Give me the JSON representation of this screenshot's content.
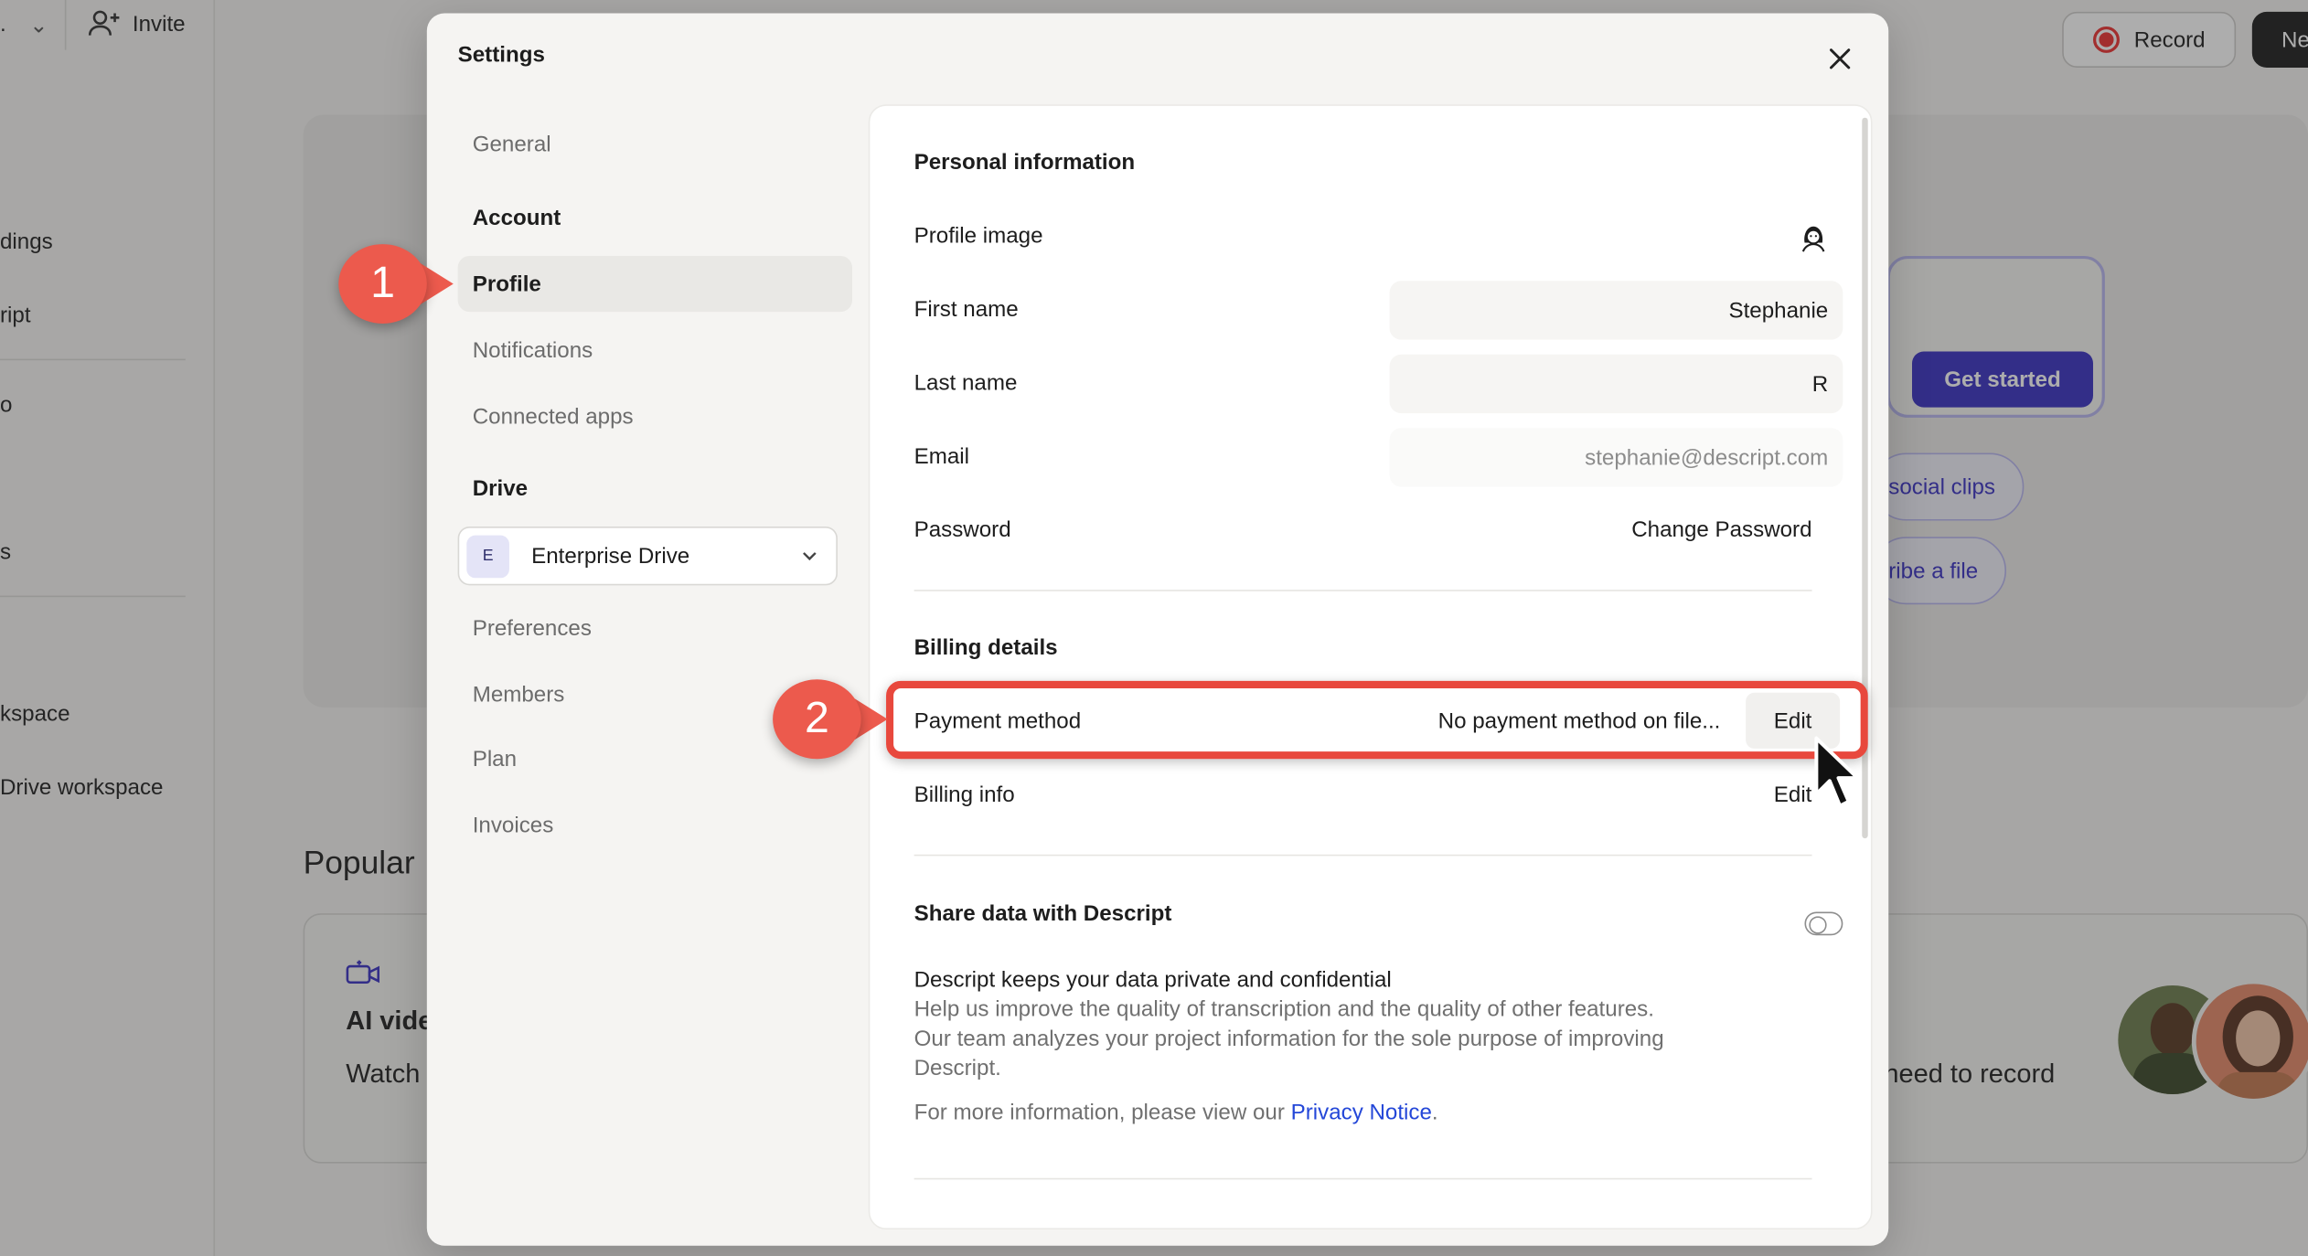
{
  "background": {
    "top_left_label": ".",
    "invite_label": "Invite",
    "sidebar_items": [
      "dings",
      "ript",
      "o",
      "s",
      "kspace",
      "Drive workspace"
    ],
    "record_label": "Record",
    "new_label": "Ne",
    "get_started_label": "Get started",
    "pill_1": "social clips",
    "pill_2": "ribe a file",
    "popular_label": "Popular",
    "card_title": "AI vide",
    "card_subtitle": "Watch",
    "card_right_text": "need to record"
  },
  "modal": {
    "title": "Settings",
    "nav": {
      "general": "General",
      "account_heading": "Account",
      "profile": "Profile",
      "notifications": "Notifications",
      "connected_apps": "Connected apps",
      "drive_heading": "Drive",
      "drive_badge": "E",
      "drive_name": "Enterprise Drive",
      "preferences": "Preferences",
      "members": "Members",
      "plan": "Plan",
      "invoices": "Invoices"
    },
    "personal": {
      "heading": "Personal information",
      "profile_image_label": "Profile image",
      "first_name_label": "First name",
      "first_name_value": "Stephanie",
      "last_name_label": "Last name",
      "last_name_value": "R",
      "email_label": "Email",
      "email_value": "stephanie@descript.com",
      "password_label": "Password",
      "change_password": "Change Password"
    },
    "billing": {
      "heading": "Billing details",
      "payment_method_label": "Payment method",
      "payment_method_value": "No payment method on file...",
      "payment_edit": "Edit",
      "billing_info_label": "Billing info",
      "billing_edit": "Edit"
    },
    "share": {
      "heading": "Share data with Descript",
      "toggle_on": false,
      "line1": "Descript keeps your data private and confidential",
      "body": "Help us improve the quality of transcription and the quality of other features. Our team analyzes your project information for the sole purpose of improving Descript.",
      "more_info_prefix": "For more information, please view our ",
      "privacy_link": "Privacy Notice",
      "more_info_suffix": "."
    }
  },
  "annotations": {
    "step1": "1",
    "step2": "2"
  },
  "colors": {
    "accent": "#3b33c4",
    "callout": "#ec5a4d",
    "highlight": "#e8483d",
    "link": "#2447d8"
  }
}
